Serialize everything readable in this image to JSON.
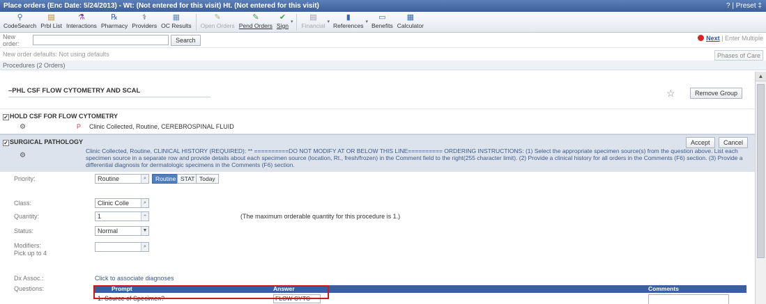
{
  "window": {
    "title": "Place orders (Enc Date: 5/24/2013) - Wt: (Not entered for this visit) Ht. (Not entered for this visit)",
    "right_text": "? | Preset ‡"
  },
  "toolbar": {
    "items": [
      {
        "label": "CodeSearch",
        "icon": "search-icon",
        "glyph": "⚲",
        "color": "#3a68b0"
      },
      {
        "label": "Prbl List",
        "icon": "list-icon",
        "glyph": "▤",
        "color": "#b88a2a"
      },
      {
        "label": "Interactions",
        "icon": "interactions-icon",
        "glyph": "⚗",
        "color": "#7a3da8"
      },
      {
        "label": "Pharmacy",
        "icon": "pharmacy-icon",
        "glyph": "℞",
        "color": "#3a68b0"
      },
      {
        "label": "Providers",
        "icon": "providers-icon",
        "glyph": "⚕",
        "color": "#555555"
      },
      {
        "label": "OC Results",
        "icon": "results-icon",
        "glyph": "▦",
        "color": "#6b8bb5"
      },
      {
        "label": "Open Orders",
        "icon": "open-orders-icon",
        "glyph": "✎",
        "color": "#9bb87a",
        "disabled": true
      },
      {
        "label": "Pend Orders",
        "icon": "pend-orders-icon",
        "glyph": "✎",
        "color": "#3f9e3f",
        "underline": true
      },
      {
        "label": "Sign",
        "icon": "sign-icon",
        "glyph": "✔",
        "color": "#3f9e3f",
        "underline": true,
        "dropdown": true
      },
      {
        "label": "Financial",
        "icon": "financial-icon",
        "glyph": "▤",
        "color": "#99a",
        "disabled": true,
        "dropdown": true
      },
      {
        "label": "References",
        "icon": "references-icon",
        "glyph": "▮",
        "color": "#3a68b0",
        "dropdown": true
      },
      {
        "label": "Benefits",
        "icon": "benefits-icon",
        "glyph": "▭",
        "color": "#3a68b0"
      },
      {
        "label": "Calculator",
        "icon": "calculator-icon",
        "glyph": "▦",
        "color": "#3a68b0"
      }
    ]
  },
  "new_order": {
    "label": "New order:",
    "value": "",
    "search_label": "Search",
    "next_label": "Next",
    "enter_multiple": "| Enter Multiple",
    "phases_label": "Phases of Care",
    "defaults_text": "New order defaults: Not using defaults"
  },
  "procedures": {
    "header": "Procedures (2 Orders)",
    "group_name": "PHL CSF FLOW CYTOMETRY AND SCAL",
    "remove_group": "Remove Group",
    "order1": {
      "name": "HOLD CSF FOR FLOW CYTOMETRY",
      "flag": "P",
      "detail": "Clinic Collected, Routine, CEREBROSPINAL FLUID"
    },
    "order2": {
      "name": "SURGICAL PATHOLOGY",
      "accept": "Accept",
      "cancel": "Cancel",
      "detail": "Clinic Collected, Routine, CLINICAL HISTORY (REQUIRED): ** ==========DO NOT MODIFY AT OR BELOW THIS LINE========== ORDERING INSTRUCTIONS: (1) Select the appropriate specimen source(s) from the question above. List each specimen source in a separate row and provide details about each specimen source (location, Rt., fresh/frozen) in the Comment field to the right(255 character limit). (2) Provide a clinical history for all orders in the Comments (F6) section. (3) Provide a differential diagnosis for dermatologic specimens in the Comments (F6) section."
    }
  },
  "form": {
    "priority_label": "Priority:",
    "priority_value": "Routine",
    "priority_options": [
      "Routine",
      "STAT",
      "Today"
    ],
    "class_label": "Class:",
    "class_value": "Clinic Colle",
    "quantity_label": "Quantity:",
    "quantity_value": "1",
    "quantity_note": "(The maximum orderable quantity for this procedure is 1.)",
    "status_label": "Status:",
    "status_value": "Normal",
    "modifiers_label": "Modifiers:",
    "modifiers_sub": "Pick up to 4",
    "dx_label": "Dx Assoc.:",
    "dx_link": "Click to associate diagnoses",
    "questions_label": "Questions:"
  },
  "questions": {
    "headers": {
      "prompt": "Prompt",
      "answer": "Answer",
      "comments": "Comments"
    },
    "rows": [
      {
        "prompt": "1.  Source of Specimen?",
        "answer": "FLOW CYTC",
        "comment": ""
      }
    ]
  },
  "colors": {
    "title_bar": "#3d5f9a",
    "question_header": "#3a5f9e",
    "highlight_box": "#d01818",
    "selected_pill": "#4e7ec2"
  }
}
